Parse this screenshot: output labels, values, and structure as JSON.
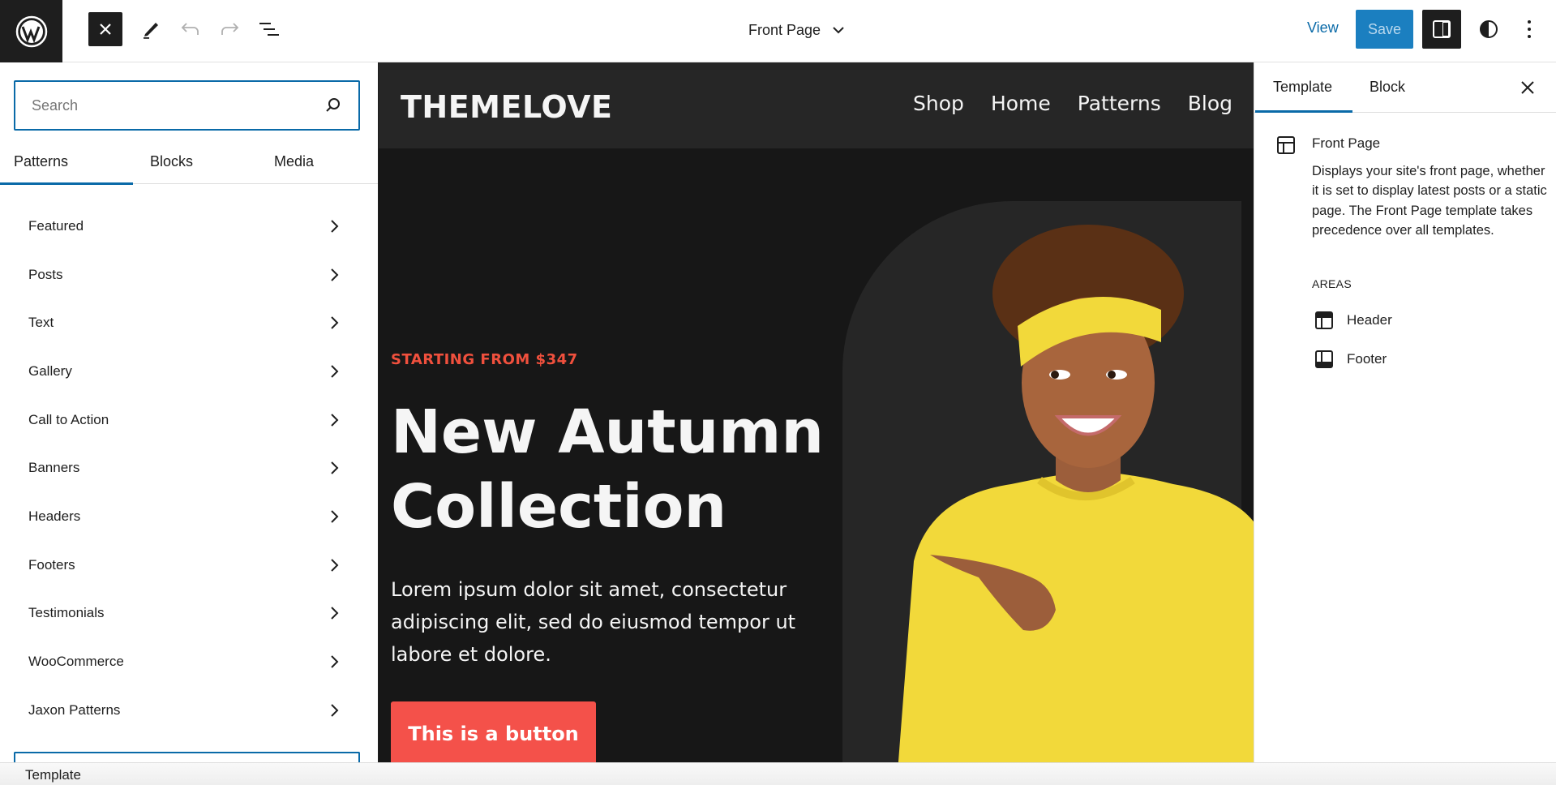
{
  "topbar": {
    "logo_icon": "wordpress-logo-icon",
    "close_icon": "close-icon",
    "tools_icon": "pencil-icon",
    "undo_icon": "undo-icon",
    "redo_icon": "redo-icon",
    "list_view_icon": "list-view-icon",
    "document_title": "Front Page",
    "view_label": "View",
    "save_label": "Save",
    "settings_icon": "sidebar-toggle-icon",
    "styles_icon": "half-circle-contrast-icon",
    "more_icon": "vertical-ellipsis-icon"
  },
  "inserter": {
    "search_placeholder": "Search",
    "search_value": "",
    "tabs": [
      {
        "label": "Patterns",
        "active": true
      },
      {
        "label": "Blocks",
        "active": false
      },
      {
        "label": "Media",
        "active": false
      }
    ],
    "categories": [
      {
        "label": "Featured"
      },
      {
        "label": "Posts"
      },
      {
        "label": "Text"
      },
      {
        "label": "Gallery"
      },
      {
        "label": "Call to Action"
      },
      {
        "label": "Banners"
      },
      {
        "label": "Headers"
      },
      {
        "label": "Footers"
      },
      {
        "label": "Testimonials"
      },
      {
        "label": "WooCommerce"
      },
      {
        "label": "Jaxon Patterns"
      }
    ]
  },
  "canvas": {
    "site_logo": "THEMELOVE",
    "nav": [
      "Shop",
      "Home",
      "Patterns",
      "Blog"
    ],
    "kicker": "STARTING FROM $347",
    "hero_title": "New Autumn Collection",
    "hero_body": "Lorem ipsum dolor sit amet, consectetur adipiscing elit, sed do eiusmod tempor ut labore et dolore.",
    "button_label": "This is a button",
    "image_alt": "Smiling woman in yellow sweater and headband pointing left",
    "colors": {
      "accent": "#f4514a",
      "background": "#171717",
      "header_bg": "#262626"
    }
  },
  "sidebar": {
    "tabs": [
      {
        "label": "Template",
        "active": true
      },
      {
        "label": "Block",
        "active": false
      }
    ],
    "template_title": "Front Page",
    "template_description": "Displays your site's front page, whether it is set to display latest posts or a static page. The Front Page template takes precedence over all templates.",
    "areas_label": "AREAS",
    "areas": [
      {
        "label": "Header",
        "icon": "header-area-icon"
      },
      {
        "label": "Footer",
        "icon": "footer-area-icon"
      }
    ]
  },
  "footer": {
    "breadcrumb": "Template"
  },
  "colors": {
    "admin_accent": "#0a6aa8",
    "save_button": "#1b7fc0"
  }
}
